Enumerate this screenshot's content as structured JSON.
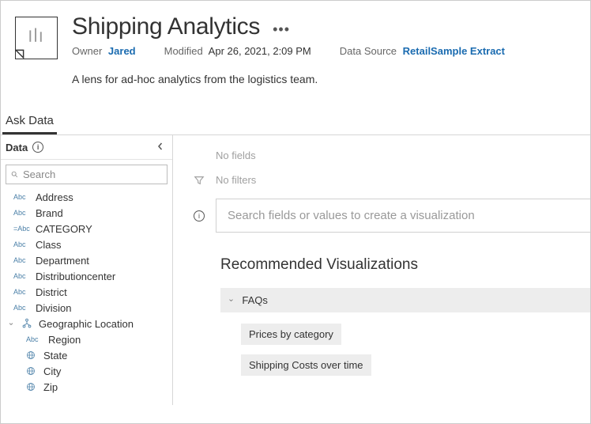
{
  "header": {
    "title": "Shipping Analytics",
    "owner_label": "Owner",
    "owner_value": "Jared",
    "modified_label": "Modified",
    "modified_value": "Apr 26, 2021, 2:09 PM",
    "datasource_label": "Data Source",
    "datasource_value": "RetailSample Extract",
    "description": "A lens for ad-hoc analytics from the logistics team."
  },
  "tabs": {
    "ask_data": "Ask Data"
  },
  "sidebar": {
    "heading": "Data",
    "search_placeholder": "Search",
    "fields": [
      {
        "type": "Abc",
        "label": "Address"
      },
      {
        "type": "Abc",
        "label": "Brand"
      },
      {
        "type": "=Abc",
        "label": "CATEGORY"
      },
      {
        "type": "Abc",
        "label": "Class"
      },
      {
        "type": "Abc",
        "label": "Department"
      },
      {
        "type": "Abc",
        "label": "Distributioncenter"
      },
      {
        "type": "Abc",
        "label": "District"
      },
      {
        "type": "Abc",
        "label": "Division"
      }
    ],
    "group": {
      "label": "Geographic Location",
      "children": [
        {
          "type": "Abc",
          "label": "Region"
        },
        {
          "type": "globe",
          "label": "State"
        },
        {
          "type": "globe",
          "label": "City"
        },
        {
          "type": "globe",
          "label": "Zip"
        }
      ]
    }
  },
  "main": {
    "no_fields": "No fields",
    "no_filters": "No filters",
    "viz_search_placeholder": "Search fields or values to create a visualization",
    "recs_title": "Recommended Visualizations",
    "faqs_label": "FAQs",
    "faq_items": [
      {
        "label": "Prices by category"
      },
      {
        "label": "Shipping Costs over time"
      }
    ]
  }
}
